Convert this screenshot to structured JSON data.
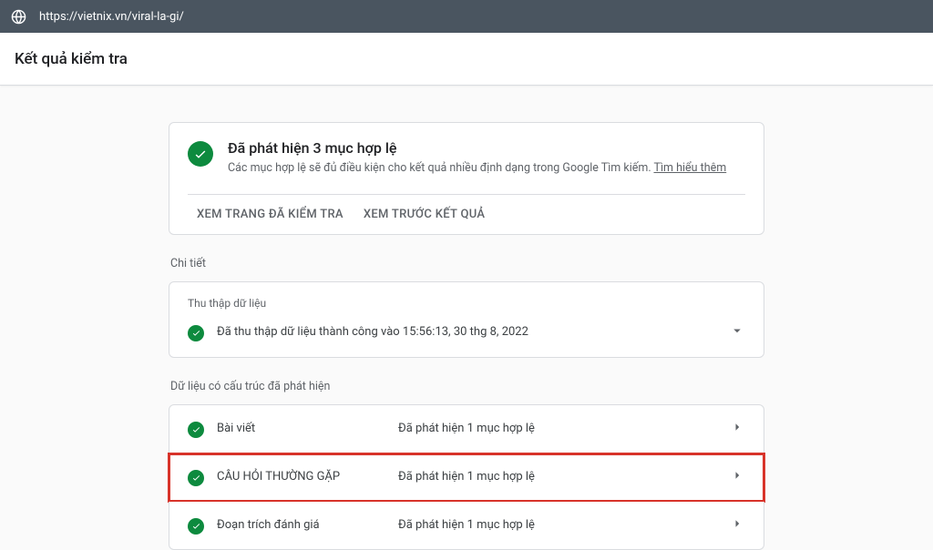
{
  "url": "https://vietnix.vn/viral-la-gi/",
  "page_title": "Kết quả kiểm tra",
  "status": {
    "heading": "Đã phát hiện 3 mục hợp lệ",
    "desc_prefix": "Các mục hợp lệ sẽ đủ điều kiện cho kết quả nhiều định dạng trong Google Tìm kiếm. ",
    "learn_more": "Tìm hiểu thêm"
  },
  "actions": {
    "view_tested": "XEM TRANG ĐÃ KIỂM TRA",
    "preview": "XEM TRƯỚC KẾT QUẢ"
  },
  "details_label": "Chi tiết",
  "crawl": {
    "label": "Thu thập dữ liệu",
    "message": "Đã thu thập dữ liệu thành công vào 15:56:13, 30 thg 8, 2022"
  },
  "structured_label": "Dữ liệu có cấu trúc đã phát hiện",
  "items": [
    {
      "name": "Bài viết",
      "status": "Đã phát hiện 1 mục hợp lệ",
      "highlighted": false
    },
    {
      "name": "CÂU HỎI THƯỜNG GẶP",
      "status": "Đã phát hiện 1 mục hợp lệ",
      "highlighted": true
    },
    {
      "name": "Đoạn trích đánh giá",
      "status": "Đã phát hiện 1 mục hợp lệ",
      "highlighted": false
    }
  ]
}
